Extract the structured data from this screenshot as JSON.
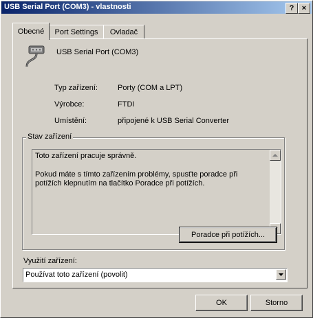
{
  "window": {
    "title": "USB Serial Port (COM3) - vlastnosti",
    "help_label": "?",
    "close_label": "×"
  },
  "tabs": [
    {
      "label": "Obecné",
      "active": true
    },
    {
      "label": "Port Settings",
      "active": false
    },
    {
      "label": "Ovladač",
      "active": false
    }
  ],
  "device": {
    "name": "USB Serial Port (COM3)",
    "icon": "serial-port-icon",
    "properties": [
      {
        "label": "Typ zařízení:",
        "value": "Porty (COM a LPT)"
      },
      {
        "label": "Výrobce:",
        "value": "FTDI"
      },
      {
        "label": "Umístění:",
        "value": "připojené k USB Serial Converter"
      }
    ]
  },
  "status": {
    "group_label": "Stav zařízení",
    "line1": "Toto zařízení pracuje správně.",
    "line2": "Pokud máte s tímto zařízením problémy, spusťte poradce při potížích klepnutím na tlačítko Poradce při potížích.",
    "troubleshoot_label": "Poradce při potížích..."
  },
  "usage": {
    "label": "Využití zařízení:",
    "selected": "Používat toto zařízení (povolit)"
  },
  "buttons": {
    "ok": "OK",
    "cancel": "Storno"
  }
}
